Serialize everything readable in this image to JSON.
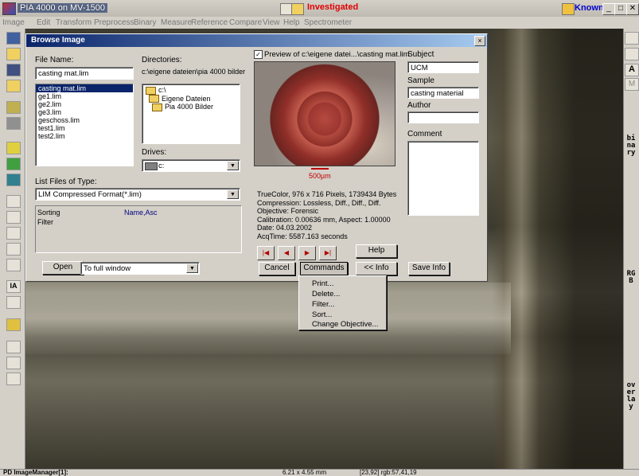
{
  "app": {
    "title": "PIA 4000 on MV-1500",
    "status": "Investigated",
    "known_label": "Known",
    "min": "_",
    "max": "□",
    "close": "✕"
  },
  "menu": [
    "Image",
    "Edit",
    "Transform",
    "Preprocess",
    "Binary",
    "Measure",
    "Reference",
    "Compare",
    "View",
    "Help",
    "Spectrometer"
  ],
  "right_toolbar": {
    "a_label": "A",
    "m_label": "M",
    "binary": "binary",
    "rgb": "RGB",
    "overlay": "overlay"
  },
  "left_toolbar": {
    "ia_label": "IA"
  },
  "dialog": {
    "title": "Browse Image",
    "close": "×",
    "file_name_label": "File Name:",
    "file_name_value": "casting mat.lim",
    "files": [
      "casting mat.lim",
      "ge1.lim",
      "ge2.lim",
      "ge3.lim",
      "geschoss.lim",
      "test1.lim",
      "test2.lim"
    ],
    "selected_file_index": 0,
    "directories_label": "Directories:",
    "directory_path": "c:\\eigene dateien\\pia 4000 bilder",
    "directories": [
      "c:\\",
      "Eigene Dateien",
      "Pia 4000 Bilder"
    ],
    "drives_label": "Drives:",
    "drive_value": "c:",
    "list_type_label": "List Files of Type:",
    "list_type_value": "LIM Compressed Format(*.lim)",
    "sorting_label": "Sorting",
    "sorting_value": "Name,Asc",
    "filter_label": "Filter",
    "preview_label": "Preview of",
    "preview_path": "c:\\eigene datei...\\casting mat.lim",
    "scale_label": "500µm",
    "info_lines": [
      "TrueColor, 976 x 716 Pixels, 1739434 Bytes",
      "Compression: Lossless, Diff., Diff., Diff.",
      "Objective: Forensic",
      "Calibration: 0.00636 mm,  Aspect: 1.00000",
      "Date: 04.03.2002",
      "AcqTime: 5587.163 seconds"
    ],
    "subject_label": "Subject",
    "subject_value": "UCM",
    "sample_label": "Sample",
    "sample_value": "casting material",
    "author_label": "Author",
    "author_value": "",
    "comment_label": "Comment",
    "open_button": "Open",
    "open_mode": "To full window",
    "help_button": "Help",
    "cancel_button": "Cancel",
    "commands_button": "Commands",
    "info_button": "<< Info",
    "save_info_button": "Save Info"
  },
  "commands_menu": [
    "Print...",
    "Delete...",
    "Filter...",
    "Sort...",
    "Change Objective..."
  ],
  "statusbar": {
    "left": "PD  ImageManager[1]:",
    "size": "6.21 x 4.55 mm",
    "pixel": "[23,92] rgb:57,41,19"
  }
}
